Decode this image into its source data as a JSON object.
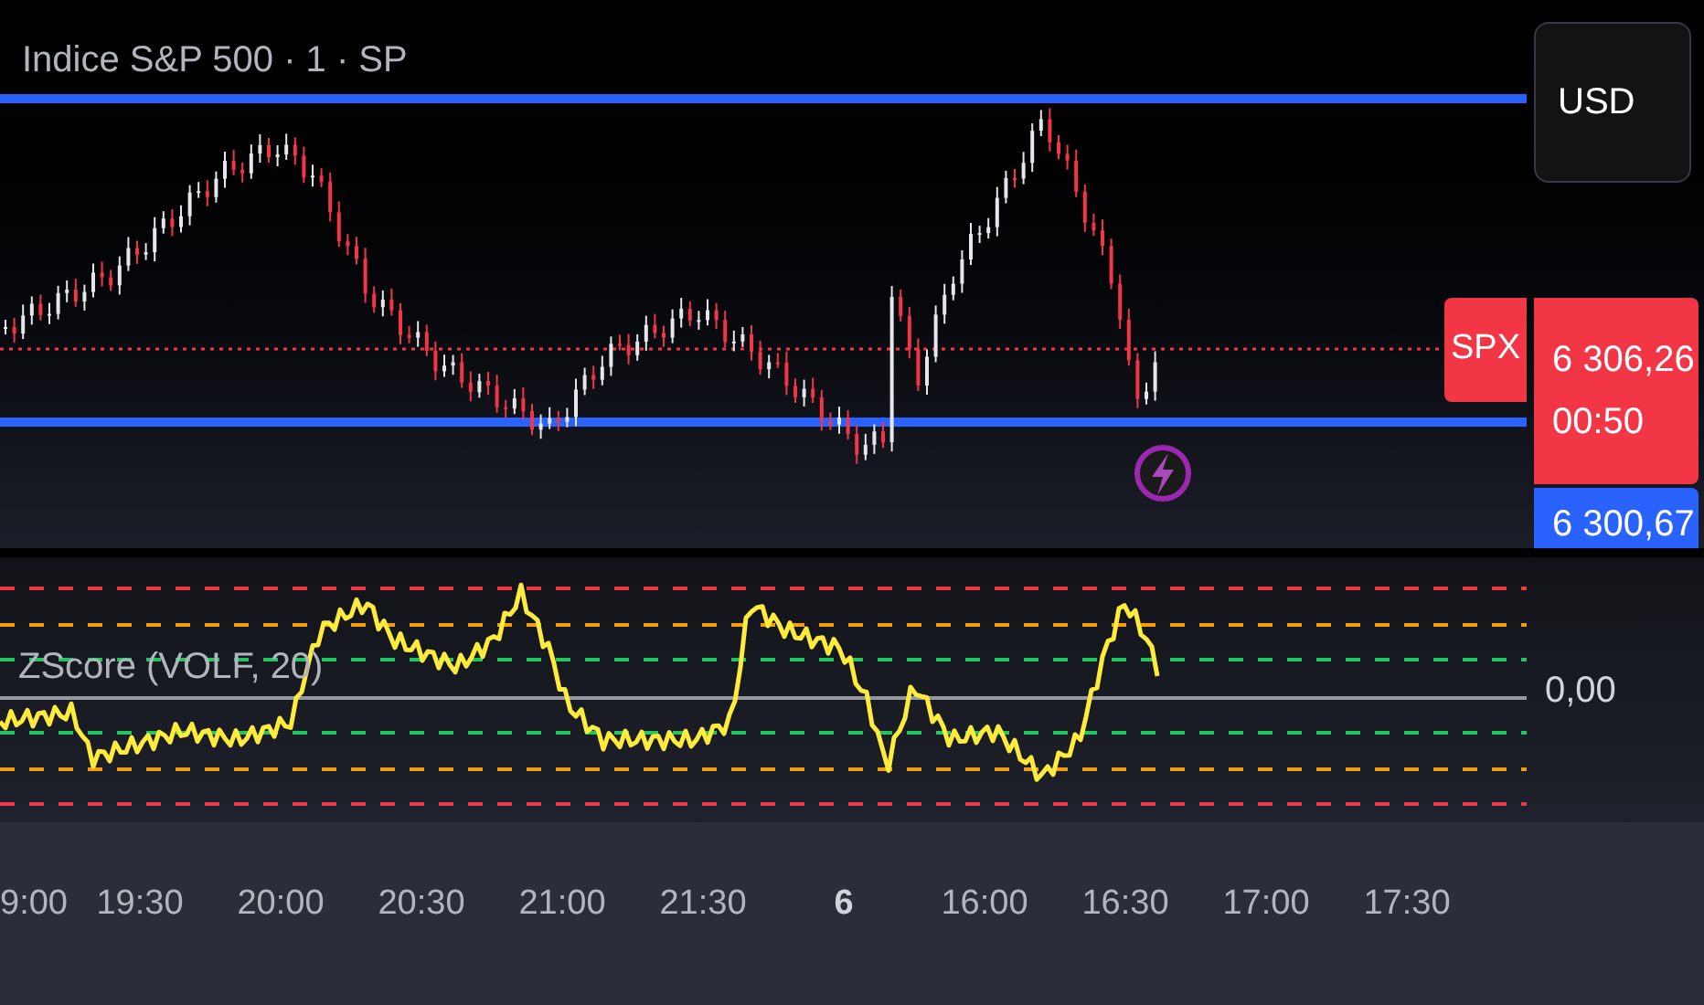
{
  "chart": {
    "title": "Indice S&P 500 · 1 · SP",
    "currency_button": "USD",
    "symbol_label": "SPX",
    "last_price": "6 306,26",
    "countdown": "00:50",
    "level_price": "6 300,67"
  },
  "indicator": {
    "label": "ZScore (VOLF, 20)",
    "zero_label": "0,00"
  },
  "time_axis": [
    {
      "label": "9:00",
      "kind": "time"
    },
    {
      "label": "19:30",
      "kind": "time"
    },
    {
      "label": "20:00",
      "kind": "time"
    },
    {
      "label": "20:30",
      "kind": "time"
    },
    {
      "label": "21:00",
      "kind": "time"
    },
    {
      "label": "21:30",
      "kind": "time"
    },
    {
      "label": "6",
      "kind": "day"
    },
    {
      "label": "16:00",
      "kind": "time"
    },
    {
      "label": "16:30",
      "kind": "time"
    },
    {
      "label": "17:00",
      "kind": "time"
    },
    {
      "label": "17:30",
      "kind": "time"
    }
  ]
}
